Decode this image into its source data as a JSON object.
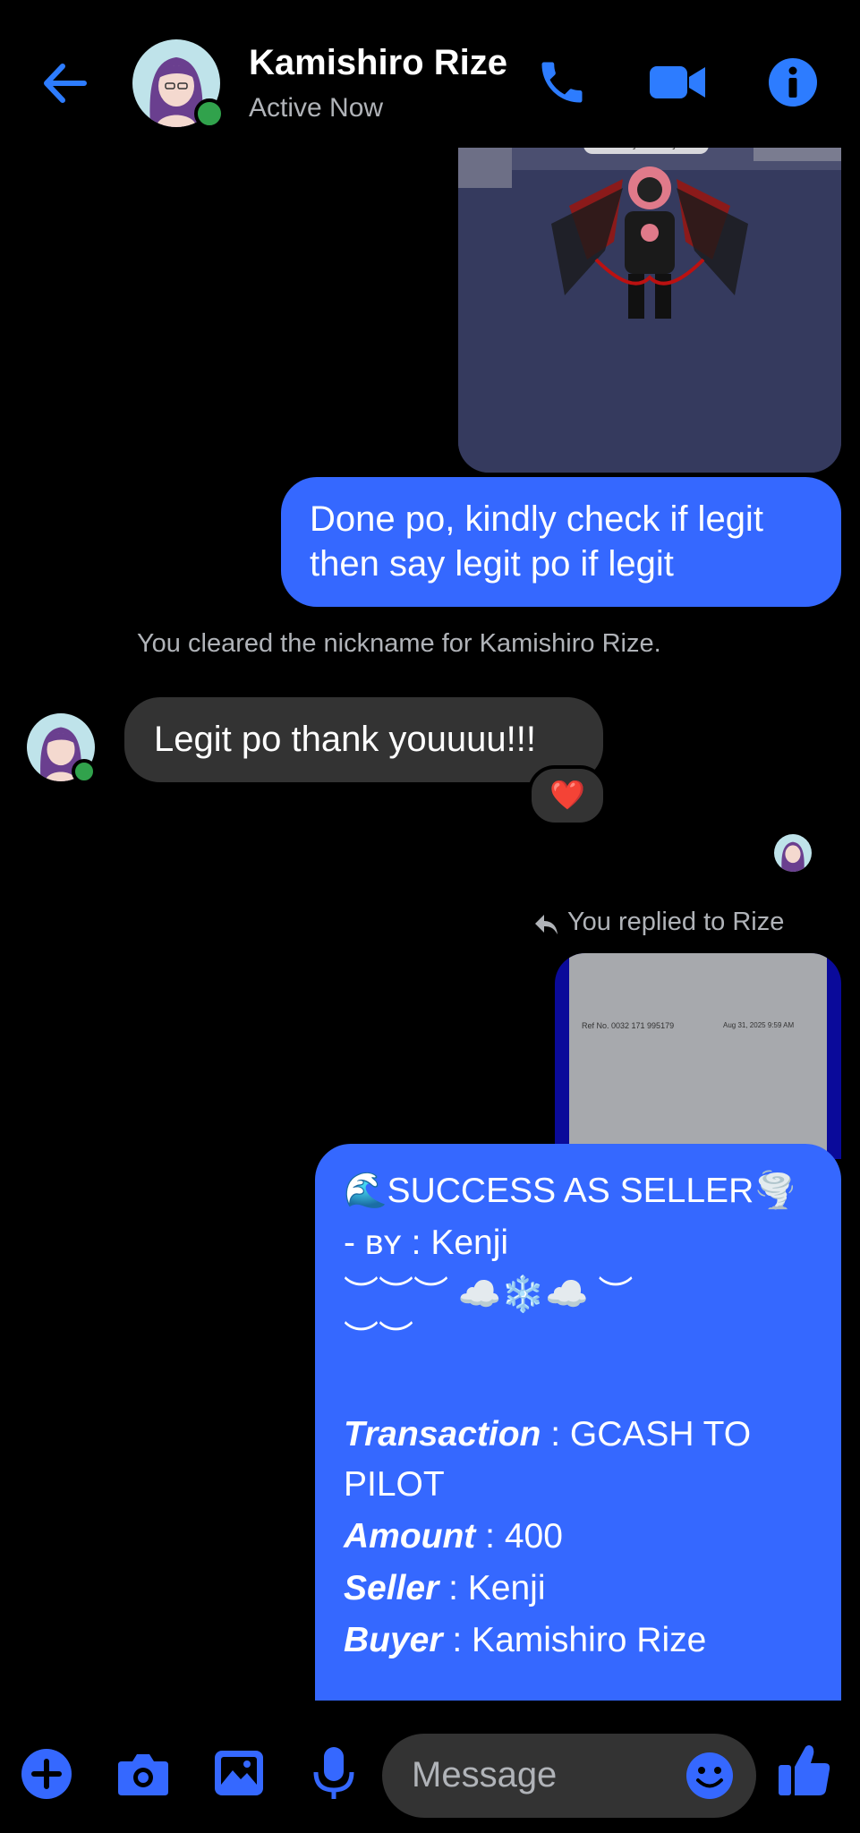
{
  "header": {
    "contact_name": "Kamishiro Rize",
    "status": "Active Now",
    "accent": "#2d7cff",
    "icons": [
      "back-arrow-icon",
      "phone-icon",
      "video-camera-icon",
      "info-icon"
    ]
  },
  "messages": {
    "image_caption": "itsjustkenji",
    "outgoing_1": [
      "Done po, kindly check if legit",
      "then say legit po if legit"
    ],
    "system_note": "You cleared the nickname for Kamishiro Rize.",
    "incoming_1": "Legit po thank youuuu!!!",
    "reaction": "❤️",
    "replied_note": "You replied to Rize",
    "receipt_ref": "Ref No. 0032 171 995179",
    "receipt_date": "Aug 31, 2025 9:59 AM",
    "reply_lines": {
      "heading": "🌊SUCCESS AS SELLER🌪️",
      "by_prefix": "- ʙʏ : ",
      "by_name": "Kenji",
      "deco_1": "︶︶︶ ☁️❄️☁️ ︶",
      "deco_2": "︶︶",
      "transaction_label": "Transaction",
      "transaction_value": " : GCASH TO",
      "transaction_value_2": "PILOT",
      "amount_label": "Amount",
      "amount_value": " : 400",
      "seller_label": "Seller",
      "seller_value": " : Kenji",
      "buyer_label": "Buyer",
      "buyer_value": " : Kamishiro Rize"
    }
  },
  "composer": {
    "placeholder": "Message",
    "icons": [
      "plus-icon",
      "camera-icon",
      "gallery-icon",
      "microphone-icon",
      "emoji-icon",
      "thumbs-up-icon"
    ]
  },
  "colors": {
    "bubble_out": "#3568ff",
    "bubble_in": "#333333",
    "online": "#31a24c"
  }
}
